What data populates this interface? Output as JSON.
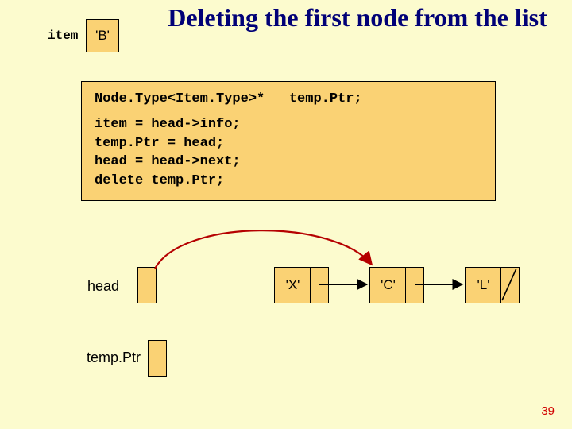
{
  "title": "Deleting the first node from the list",
  "item_label": "item",
  "item_value": "'B'",
  "code": {
    "decl": "Node.Type<Item.Type>*   temp.Ptr;",
    "l1": "item = head->info;",
    "l2": "temp.Ptr = head;",
    "l3": "head = head->next;",
    "l4": "delete  temp.Ptr;"
  },
  "labels": {
    "head": "head",
    "tempptr": "temp.Ptr"
  },
  "nodes": {
    "x": "'X'",
    "c": "'C'",
    "l": "'L'"
  },
  "page_number": "39"
}
